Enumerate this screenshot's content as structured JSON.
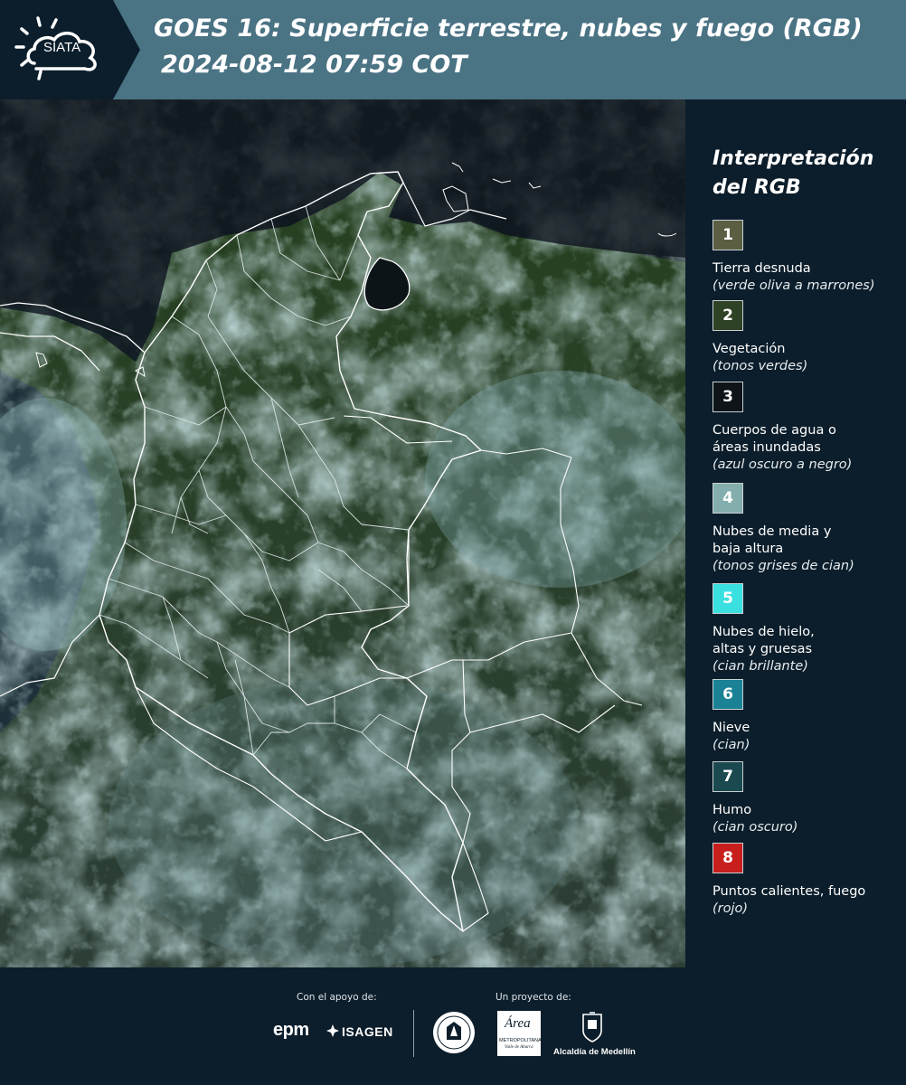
{
  "header": {
    "logo_text": "SIATA",
    "title_line1": "GOES 16: Superficie terrestre, nubes y fuego (RGB)",
    "title_line2": "2024-08-12 07:59 COT"
  },
  "legend": {
    "title": "Interpretación del RGB",
    "items": [
      {
        "number": "1",
        "label": "Tierra desnuda",
        "note": "(verde oliva a marrones)",
        "color": "#5c5e44",
        "text_color": "#ffffff"
      },
      {
        "number": "2",
        "label": "Vegetación",
        "note": "(tonos verdes)",
        "color": "#2e4226",
        "text_color": "#ffffff"
      },
      {
        "number": "3",
        "label": "Cuerpos de agua o\náreas inundadas",
        "note": "(azul oscuro a negro)",
        "color": "#0e1418",
        "text_color": "#ffffff"
      },
      {
        "number": "4",
        "label": "Nubes de media y\nbaja altura",
        "note": "(tonos grises de cian)",
        "color": "#84aeae",
        "text_color": "#ffffff"
      },
      {
        "number": "5",
        "label": "Nubes de hielo,\naltas y gruesas",
        "note": "(cian brillante)",
        "color": "#3ae0e0",
        "text_color": "#ffffff"
      },
      {
        "number": "6",
        "label": "Nieve",
        "note": "(cian)",
        "color": "#1b8296",
        "text_color": "#ffffff"
      },
      {
        "number": "7",
        "label": "Humo",
        "note": "(cian oscuro)",
        "color": "#1a4a50",
        "text_color": "#ffffff"
      },
      {
        "number": "8",
        "label": "Puntos calientes, fuego",
        "note": "(rojo)",
        "color": "#c81e1e",
        "text_color": "#ffffff"
      }
    ]
  },
  "footer": {
    "support_label": "Con el apoyo de:",
    "project_label": "Un proyecto de:",
    "logos": {
      "epm": "epm",
      "isagen": "ISAGEN",
      "area_metro": "Área",
      "area_metro_sub": "METROPOLITANA",
      "area_metro_sub2": "Valle de Aburrá",
      "alcaldia": "Alcaldía de Medellín"
    }
  },
  "colors": {
    "header_bg": "#4a7384",
    "page_bg": "#0c1e2b",
    "border_lines": "#ffffff"
  }
}
